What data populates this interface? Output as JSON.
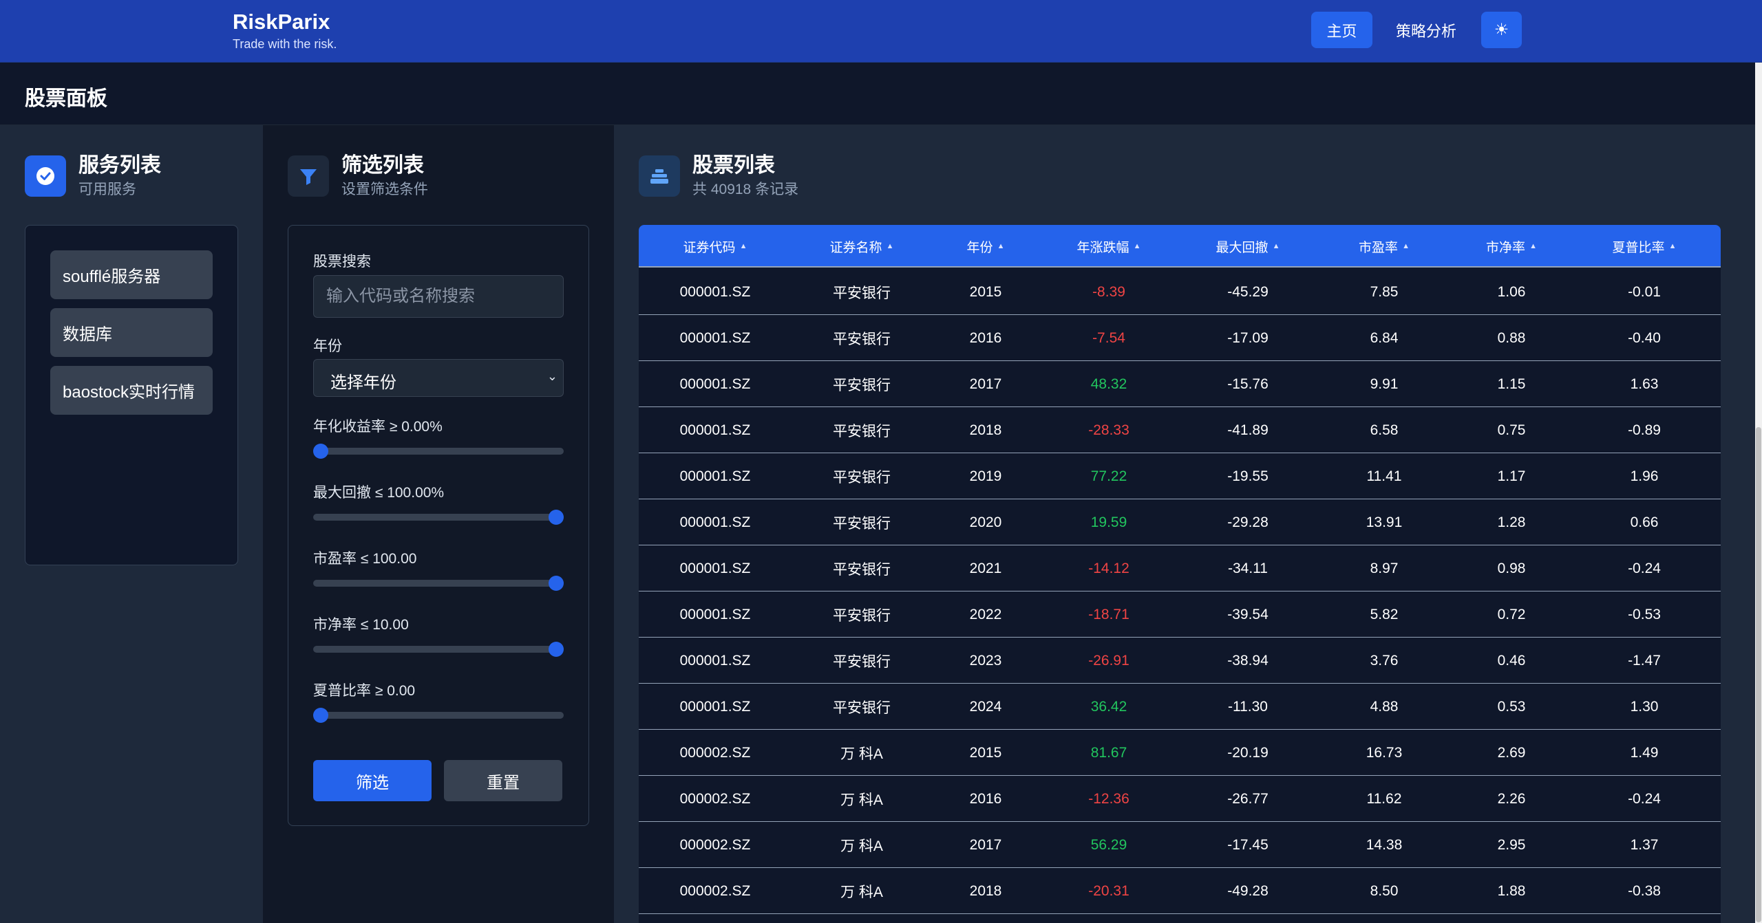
{
  "brand": {
    "name": "RiskParix",
    "tagline": "Trade with the risk."
  },
  "nav": {
    "home": "主页",
    "strategy": "策略分析",
    "theme_icon": "☀"
  },
  "page": {
    "title": "股票面板"
  },
  "services": {
    "title": "服务列表",
    "subtitle": "可用服务",
    "icon": "check-circle-icon",
    "items": [
      "soufflé服务器",
      "数据库",
      "baostock实时行情"
    ]
  },
  "filter": {
    "title": "筛选列表",
    "subtitle": "设置筛选条件",
    "icon": "funnel-icon",
    "search_label": "股票搜索",
    "search_placeholder": "输入代码或名称搜索",
    "year_label": "年份",
    "year_value": "选择年份",
    "sliders": [
      {
        "label": "年化收益率 ≥ 0.00%",
        "level": 0
      },
      {
        "label": "最大回撤 ≤ 100.00%",
        "level": 1
      },
      {
        "label": "市盈率 ≤ 100.00",
        "level": 1
      },
      {
        "label": "市净率 ≤ 10.00",
        "level": 1
      },
      {
        "label": "夏普比率 ≥ 0.00",
        "level": 0
      }
    ],
    "apply_label": "筛选",
    "reset_label": "重置"
  },
  "table": {
    "title": "股票列表",
    "subtitle": "共 40918 条记录",
    "icon": "stack-icon",
    "columns": [
      "证券代码",
      "证券名称",
      "年份",
      "年涨跌幅",
      "最大回撤",
      "市盈率",
      "市净率",
      "夏普比率"
    ],
    "rows": [
      [
        "000001.SZ",
        "平安银行",
        "2015",
        "-8.39",
        "-45.29",
        "7.85",
        "1.06",
        "-0.01"
      ],
      [
        "000001.SZ",
        "平安银行",
        "2016",
        "-7.54",
        "-17.09",
        "6.84",
        "0.88",
        "-0.40"
      ],
      [
        "000001.SZ",
        "平安银行",
        "2017",
        "48.32",
        "-15.76",
        "9.91",
        "1.15",
        "1.63"
      ],
      [
        "000001.SZ",
        "平安银行",
        "2018",
        "-28.33",
        "-41.89",
        "6.58",
        "0.75",
        "-0.89"
      ],
      [
        "000001.SZ",
        "平安银行",
        "2019",
        "77.22",
        "-19.55",
        "11.41",
        "1.17",
        "1.96"
      ],
      [
        "000001.SZ",
        "平安银行",
        "2020",
        "19.59",
        "-29.28",
        "13.91",
        "1.28",
        "0.66"
      ],
      [
        "000001.SZ",
        "平安银行",
        "2021",
        "-14.12",
        "-34.11",
        "8.97",
        "0.98",
        "-0.24"
      ],
      [
        "000001.SZ",
        "平安银行",
        "2022",
        "-18.71",
        "-39.54",
        "5.82",
        "0.72",
        "-0.53"
      ],
      [
        "000001.SZ",
        "平安银行",
        "2023",
        "-26.91",
        "-38.94",
        "3.76",
        "0.46",
        "-1.47"
      ],
      [
        "000001.SZ",
        "平安银行",
        "2024",
        "36.42",
        "-11.30",
        "4.88",
        "0.53",
        "1.30"
      ],
      [
        "000002.SZ",
        "万 科A",
        "2015",
        "81.67",
        "-20.19",
        "16.73",
        "2.69",
        "1.49"
      ],
      [
        "000002.SZ",
        "万 科A",
        "2016",
        "-12.36",
        "-26.77",
        "11.62",
        "2.26",
        "-0.24"
      ],
      [
        "000002.SZ",
        "万 科A",
        "2017",
        "56.29",
        "-17.45",
        "14.38",
        "2.95",
        "1.37"
      ],
      [
        "000002.SZ",
        "万 科A",
        "2018",
        "-20.31",
        "-49.28",
        "8.50",
        "1.88",
        "-0.38"
      ]
    ]
  },
  "colors": {
    "accent": "#2563eb",
    "nav_bg": "#1e40af",
    "negative": "#ef4444",
    "positive": "#22c55e"
  }
}
